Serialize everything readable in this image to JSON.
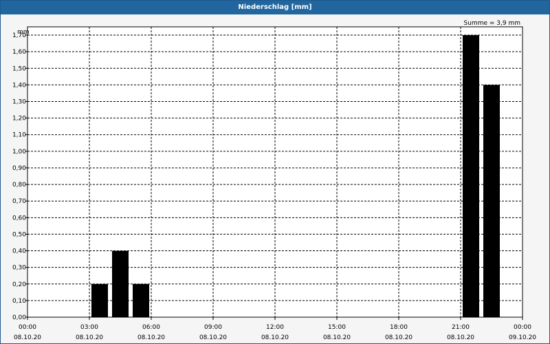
{
  "window": {
    "title": "Niederschlag [mm]"
  },
  "chart_data": {
    "type": "bar",
    "title": "Niederschlag [mm]",
    "unit_label": "mm",
    "summary_text": "Summe = 3,9 mm",
    "bar_color": "#000000",
    "grid": true,
    "xlim": [
      "2020-10-08 00:00",
      "2020-10-09 00:00"
    ],
    "ylim": [
      0,
      1.75
    ],
    "x_ticks": [
      {
        "time": "00:00",
        "date": "08.10.20"
      },
      {
        "time": "03:00",
        "date": "08.10.20"
      },
      {
        "time": "06:00",
        "date": "08.10.20"
      },
      {
        "time": "09:00",
        "date": "08.10.20"
      },
      {
        "time": "12:00",
        "date": "08.10.20"
      },
      {
        "time": "15:00",
        "date": "08.10.20"
      },
      {
        "time": "18:00",
        "date": "08.10.20"
      },
      {
        "time": "21:00",
        "date": "08.10.20"
      },
      {
        "time": "00:00",
        "date": "09.10.20"
      }
    ],
    "y_ticks": [
      "0,00",
      "0,10",
      "0,20",
      "0,30",
      "0,40",
      "0,50",
      "0,60",
      "0,70",
      "0,80",
      "0,90",
      "1,00",
      "1,10",
      "1,20",
      "1,30",
      "1,40",
      "1,50",
      "1,60",
      "1,70"
    ],
    "bars": [
      {
        "start": "2020-10-08 03:00",
        "end": "2020-10-08 04:00",
        "value": 0.2
      },
      {
        "start": "2020-10-08 04:00",
        "end": "2020-10-08 05:00",
        "value": 0.4
      },
      {
        "start": "2020-10-08 05:00",
        "end": "2020-10-08 06:00",
        "value": 0.2
      },
      {
        "start": "2020-10-08 21:00",
        "end": "2020-10-08 22:00",
        "value": 1.7
      },
      {
        "start": "2020-10-08 22:00",
        "end": "2020-10-08 23:00",
        "value": 1.4
      }
    ]
  }
}
